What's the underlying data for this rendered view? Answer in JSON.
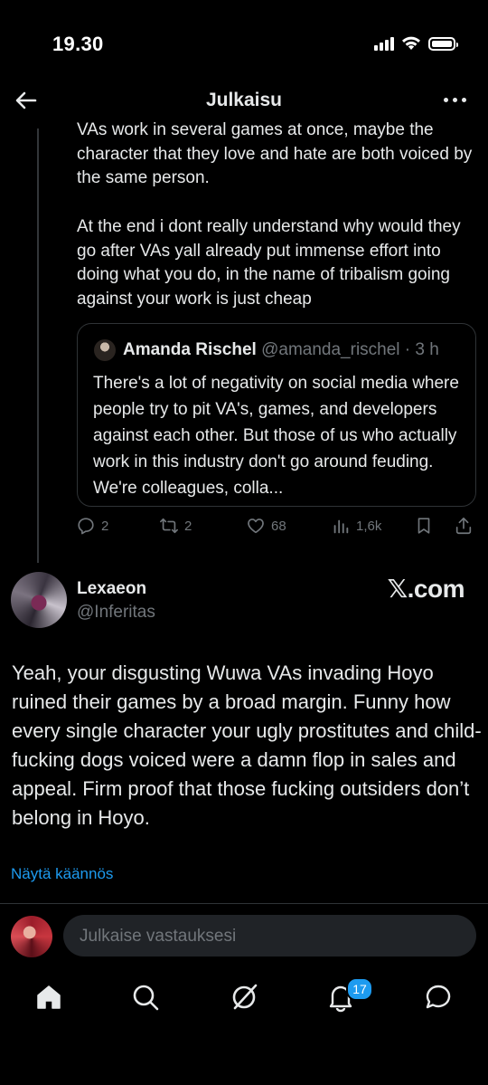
{
  "status_bar": {
    "time": "19.30"
  },
  "header": {
    "title": "Julkaisu"
  },
  "parent_tweet": {
    "text_part1": "VAs work in several games at once, maybe the character that they love and hate are both voiced by the same person.",
    "text_part2": "At the end i dont really understand why would they go after VAs yall already put immense effort into doing what you do, in the name of tribalism going against your work is just cheap",
    "quote": {
      "name": "Amanda Rischel",
      "handle_time": "@amanda_rischel · 3 h",
      "text": "There's a lot of negativity on social media where people try to pit VA's, games, and developers against each other. But those of us who actually work in this industry don't go around feuding. We're colleagues, colla..."
    },
    "actions": {
      "replies": "2",
      "reposts": "2",
      "likes": "68",
      "views": "1,6k"
    }
  },
  "focused_tweet": {
    "name": "Lexaeon",
    "handle": "@Inferitas",
    "source_label": "𝕏.com",
    "text": "Yeah, your disgusting Wuwa VAs invading Hoyo ruined their games by a broad margin. Funny how every single character your ugly prostitutes and child-fucking dogs voiced were a damn flop in sales and appeal. Firm proof that those fucking outsiders don’t belong in Hoyo.",
    "translate_label": "Näytä käännös"
  },
  "reply_box": {
    "placeholder": "Julkaise vastauksesi"
  },
  "bottom_nav": {
    "notifications_badge": "17"
  },
  "colors": {
    "accent": "#1d9bf0",
    "muted": "#71767b",
    "background": "#000000"
  }
}
